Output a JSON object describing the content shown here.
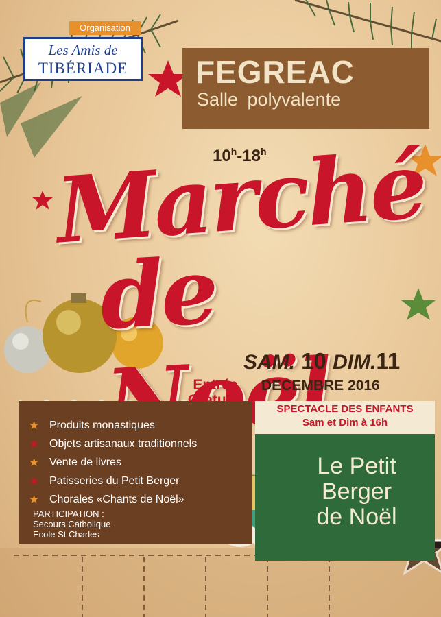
{
  "organizer": {
    "tag": "Organisation",
    "line1": "Les Amis de",
    "line2": "TIBÉRIADE"
  },
  "venue": {
    "city": "FEGREAC",
    "hall": "Salle polyvalente"
  },
  "hours": {
    "start": "10",
    "end": "18",
    "suffix": "h"
  },
  "title": {
    "line1": "Marché",
    "line2": "de Noël"
  },
  "dates": {
    "day1_label": "SAM.",
    "day1": "10",
    "day2_label": "DIM.",
    "day2": "11",
    "month_year": "DECEMBRE 2016"
  },
  "entry": {
    "line1": "Entrée",
    "line2": "Gratuite"
  },
  "offerings": [
    {
      "label": "Produits monastiques",
      "star_color": "#e8902c"
    },
    {
      "label": "Objets artisanaux traditionnels",
      "star_color": "#c8152a"
    },
    {
      "label": "Vente de livres",
      "star_color": "#e8902c"
    },
    {
      "label": "Patisseries du Petit Berger",
      "star_color": "#c8152a"
    },
    {
      "label": "Chorales «Chants de Noël»",
      "star_color": "#e8902c"
    }
  ],
  "participation": {
    "heading": "PARTICIPATION :",
    "items": [
      "Secours Catholique",
      "Ecole St Charles"
    ]
  },
  "children_show": {
    "heading1": "SPECTACLE DES ENFANTS",
    "heading2": "Sam et Dim à 16h",
    "title_lines": [
      "Le Petit",
      "Berger",
      "de Noël"
    ]
  },
  "colors": {
    "red": "#c8152a",
    "brown": "#6b3f22",
    "green": "#2f6b3a",
    "orange": "#e8902c",
    "blue": "#1d3e8f"
  }
}
